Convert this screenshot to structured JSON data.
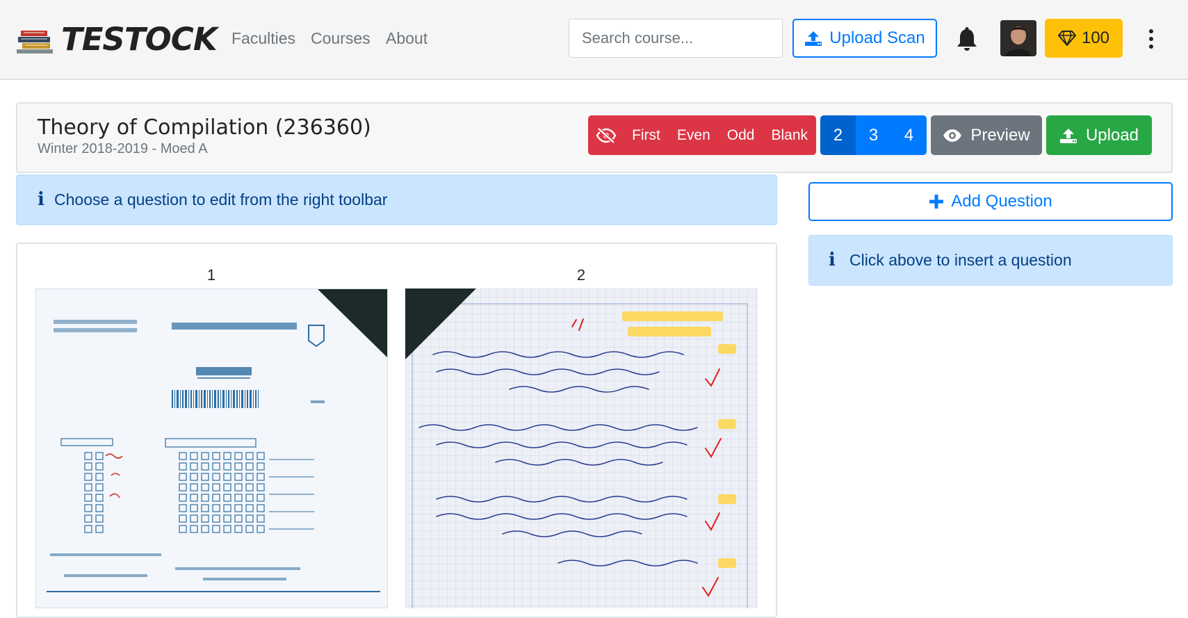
{
  "navbar": {
    "brand": "TESTOCK",
    "links": [
      "Faculties",
      "Courses",
      "About"
    ],
    "search_placeholder": "Search course...",
    "upload_scan_label": "Upload Scan",
    "credits": "100"
  },
  "course": {
    "title": "Theory of Compilation (236360)",
    "semester": "Winter 2018-2019 - Moed A"
  },
  "filters": {
    "hide_icon": "eye-slash-icon",
    "items": [
      "First",
      "Even",
      "Odd",
      "Blank"
    ]
  },
  "columns": {
    "options": [
      "2",
      "3",
      "4"
    ],
    "selected": "2"
  },
  "actions": {
    "preview_label": "Preview",
    "upload_label": "Upload"
  },
  "alerts": {
    "main": "Choose a question to edit from the right toolbar",
    "side": "Click above to insert a question"
  },
  "sidebar": {
    "add_question_label": "Add Question"
  },
  "pages": [
    {
      "number": "1"
    },
    {
      "number": "2"
    }
  ],
  "colors": {
    "primary": "#007bff",
    "danger": "#dc3545",
    "success": "#28a745",
    "secondary": "#6c757d",
    "warning": "#ffc107",
    "info_bg": "#cce5ff"
  }
}
